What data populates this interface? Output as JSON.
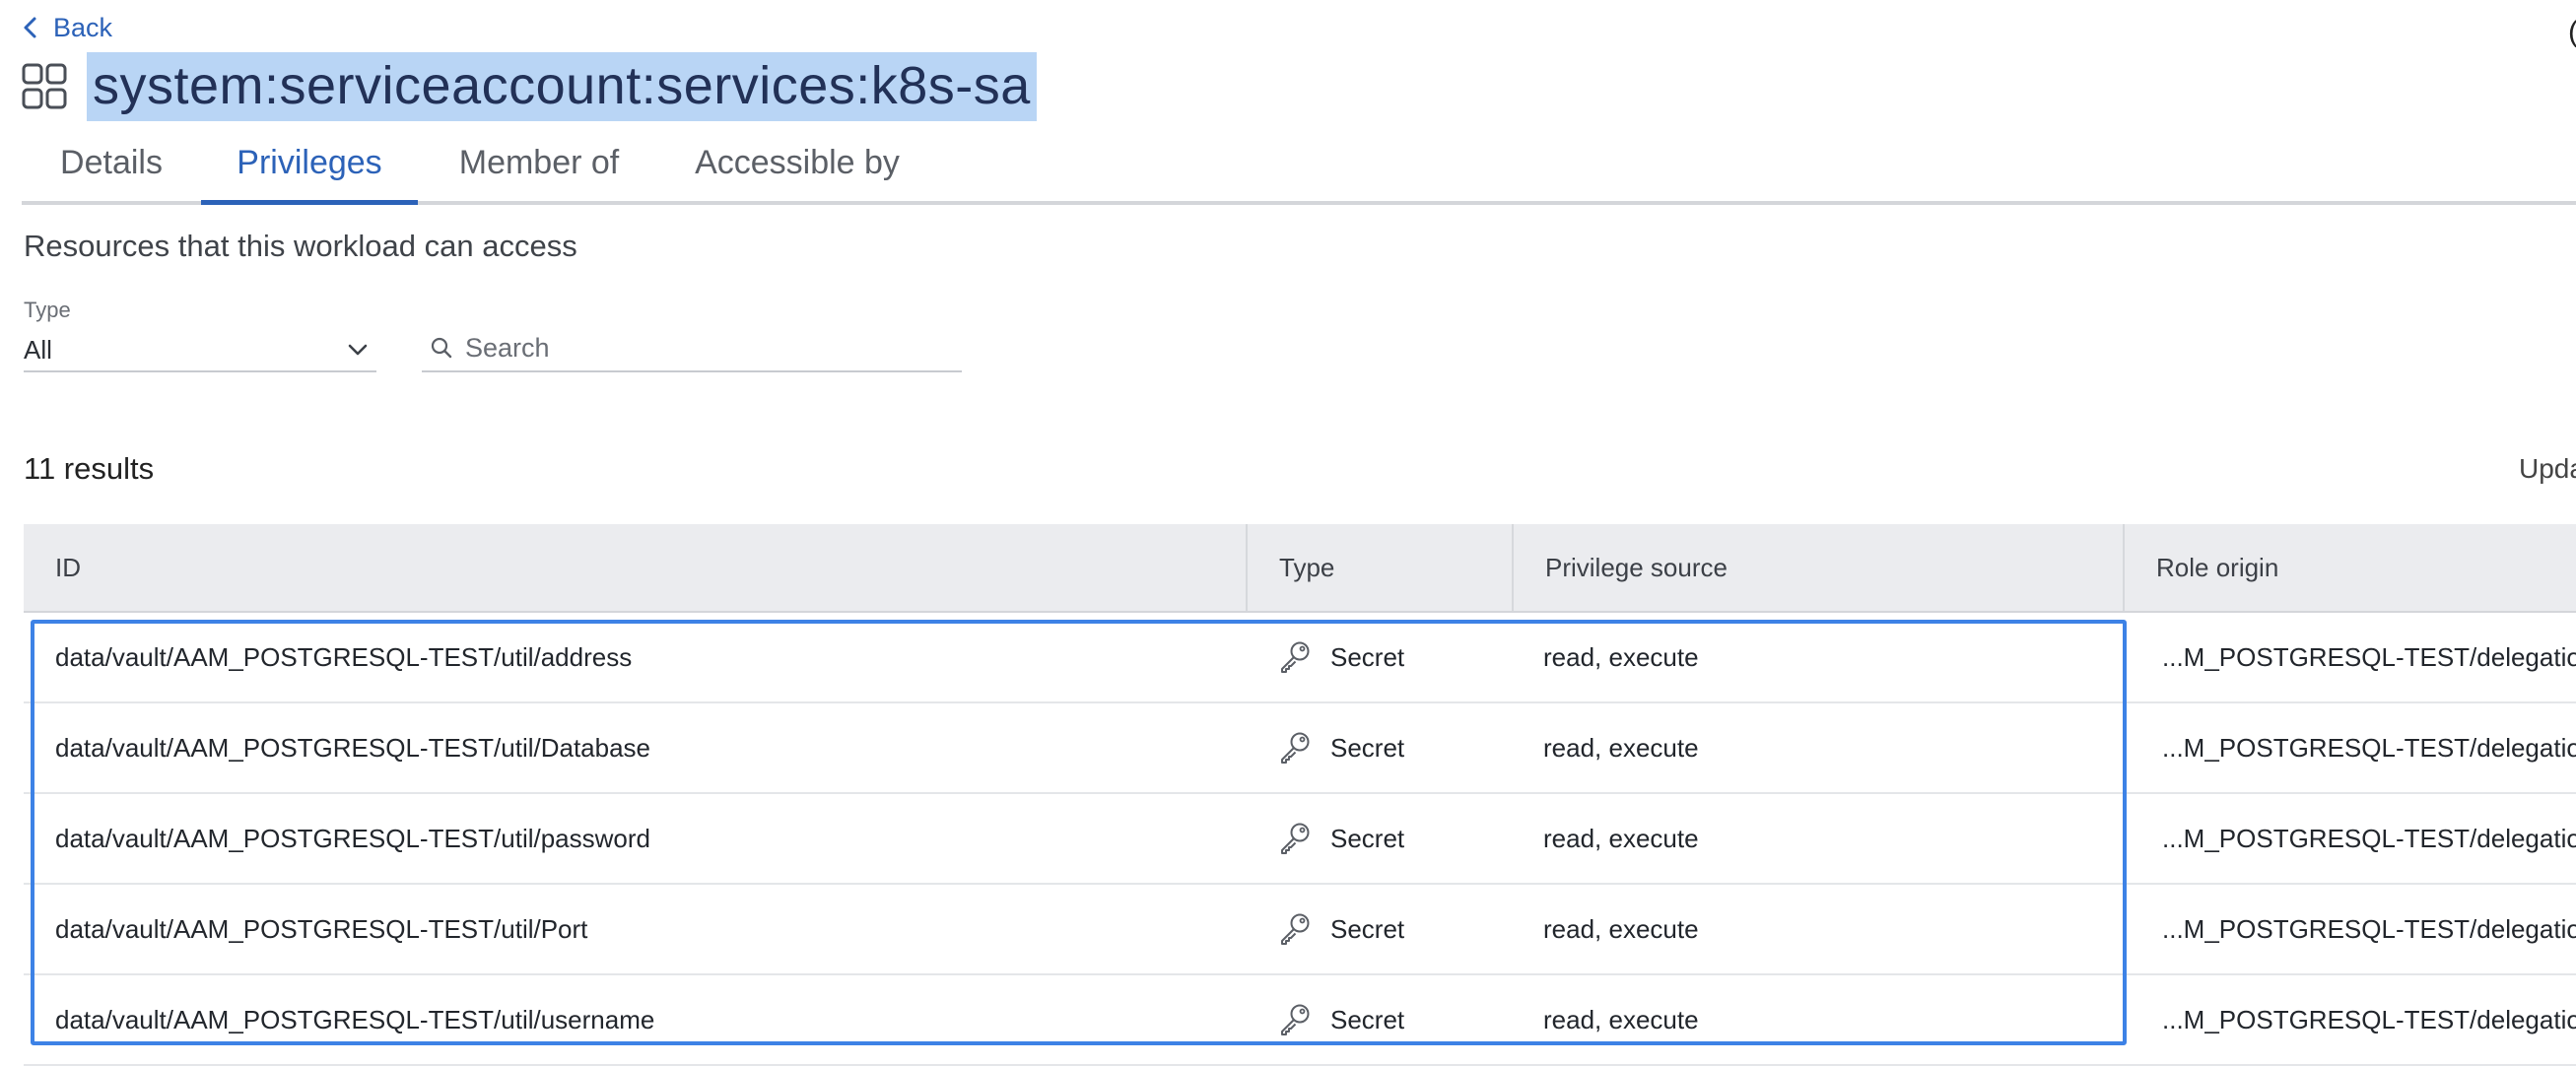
{
  "back": {
    "label": "Back"
  },
  "header": {
    "title": "system:serviceaccount:services:k8s-sa",
    "corner_glyph": "("
  },
  "tabs": [
    {
      "label": "Details",
      "active": false
    },
    {
      "label": "Privileges",
      "active": true
    },
    {
      "label": "Member of",
      "active": false
    },
    {
      "label": "Accessible by",
      "active": false
    }
  ],
  "subtitle": "Resources that this workload can access",
  "filters": {
    "type_label": "Type",
    "type_value": "All",
    "search_placeholder": "Search"
  },
  "results": {
    "count_text": "11 results",
    "updated_text": "Upda"
  },
  "table": {
    "columns": [
      "ID",
      "Type",
      "Privilege source",
      "Role origin"
    ],
    "rows": [
      {
        "id": "data/vault/AAM_POSTGRESQL-TEST/util/address",
        "type": "Secret",
        "privilege_source": "read, execute",
        "role_origin": "...M_POSTGRESQL-TEST/delegation/c"
      },
      {
        "id": "data/vault/AAM_POSTGRESQL-TEST/util/Database",
        "type": "Secret",
        "privilege_source": "read, execute",
        "role_origin": "...M_POSTGRESQL-TEST/delegation/c"
      },
      {
        "id": "data/vault/AAM_POSTGRESQL-TEST/util/password",
        "type": "Secret",
        "privilege_source": "read, execute",
        "role_origin": "...M_POSTGRESQL-TEST/delegation/c"
      },
      {
        "id": "data/vault/AAM_POSTGRESQL-TEST/util/Port",
        "type": "Secret",
        "privilege_source": "read, execute",
        "role_origin": "...M_POSTGRESQL-TEST/delegation/c"
      },
      {
        "id": "data/vault/AAM_POSTGRESQL-TEST/util/username",
        "type": "Secret",
        "privilege_source": "read, execute",
        "role_origin": "...M_POSTGRESQL-TEST/delegation/c"
      }
    ]
  },
  "icons": {
    "back": "chevron-left-icon",
    "app": "grid-apps-icon",
    "dropdown": "chevron-down-icon",
    "search": "search-icon",
    "secret": "key-icon"
  },
  "colors": {
    "accent": "#2c62b8",
    "title_highlight": "#b9d5f5",
    "selection_border": "#3d82e6",
    "header_bg": "#ebecef"
  }
}
